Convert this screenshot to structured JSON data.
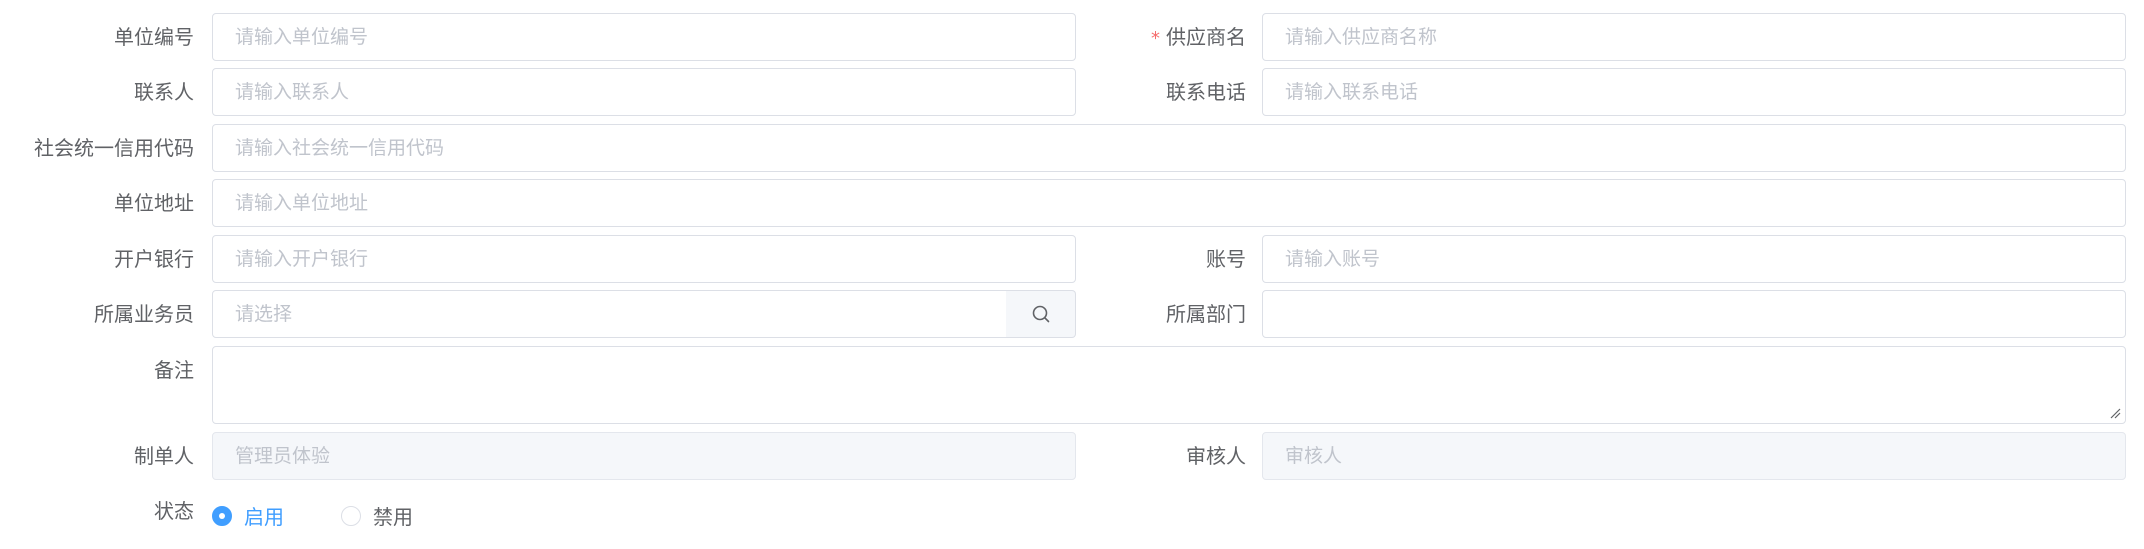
{
  "form": {
    "unit_code": {
      "label": "单位编号",
      "placeholder": "请输入单位编号"
    },
    "supplier_name": {
      "required_mark": "*",
      "label": "供应商名",
      "placeholder": "请输入供应商名称"
    },
    "contact": {
      "label": "联系人",
      "placeholder": "请输入联系人"
    },
    "phone": {
      "label": "联系电话",
      "placeholder": "请输入联系电话"
    },
    "credit_code": {
      "label": "社会统一信用代码",
      "placeholder": "请输入社会统一信用代码"
    },
    "address": {
      "label": "单位地址",
      "placeholder": "请输入单位地址"
    },
    "bank": {
      "label": "开户银行",
      "placeholder": "请输入开户银行"
    },
    "account": {
      "label": "账号",
      "placeholder": "请输入账号"
    },
    "salesperson": {
      "label": "所属业务员",
      "placeholder": "请选择",
      "icon": "search-icon"
    },
    "department": {
      "label": "所属部门",
      "value": ""
    },
    "remark": {
      "label": "备注",
      "value": ""
    },
    "creator": {
      "label": "制单人",
      "placeholder": "管理员体验"
    },
    "reviewer": {
      "label": "审核人",
      "placeholder": "审核人"
    },
    "status": {
      "label": "状态",
      "options": [
        {
          "label": "启用",
          "checked": true
        },
        {
          "label": "禁用",
          "checked": false
        }
      ]
    }
  },
  "colors": {
    "accent": "#409eff",
    "required": "#f56c6c",
    "border": "#dcdfe6",
    "placeholder": "#c0c4cc",
    "disabled_bg": "#f5f7fa"
  }
}
